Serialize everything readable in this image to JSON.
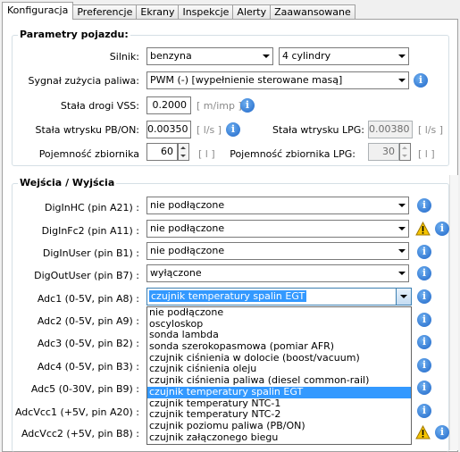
{
  "tabs": [
    "Konfiguracja",
    "Preferencje",
    "Ekrany",
    "Inspekcje",
    "Alerty",
    "Zaawansowane"
  ],
  "vehicle": {
    "title": "Parametry pojazdu:",
    "engine_label": "Silnik:",
    "engine_value": "benzyna",
    "cylinders_value": "4 cylindry",
    "fuel_signal_label": "Sygnał zużycia paliwa:",
    "fuel_signal_value": "PWM (-)  [wypełnienie sterowane masą]",
    "vss_label": "Stała drogi VSS:",
    "vss_value": "0.2000",
    "vss_unit": "[ m/imp ]",
    "pbon_label": "Stała wtrysku PB/ON:",
    "pbon_value": "0.00350",
    "pbon_unit": "[ l/s ]",
    "lpg_label": "Stała wtrysku LPG:",
    "lpg_value": "0.00380",
    "lpg_unit": "[ l/s ]",
    "tank_label": "Pojemność zbiornika",
    "tank_value": "60",
    "tank_unit": "[ l ]",
    "tank_lpg_label": "Pojemność zbiornika LPG:",
    "tank_lpg_value": "30",
    "tank_lpg_unit": "[ l ]"
  },
  "io": {
    "title": "Wejścia / Wyjścia",
    "rows": [
      {
        "label": "DigInHC (pin A21) :",
        "value": "nie podłączone"
      },
      {
        "label": "DigInFc2 (pin A11) :",
        "value": "nie podłączone"
      },
      {
        "label": "DigInUser (pin B1) :",
        "value": "nie podłączone"
      },
      {
        "label": "DigOutUser (pin B7) :",
        "value": "wyłączone"
      },
      {
        "label": "Adc1 (0-5V, pin A8) :",
        "value": "czujnik temperatury spalin EGT"
      },
      {
        "label": "Adc2 (0-5V, pin A9) :"
      },
      {
        "label": "Adc3 (0-5V, pin B2) :"
      },
      {
        "label": "Adc4 (0-5V, pin B3) :"
      },
      {
        "label": "Adc5 (0-30V, pin B9) :"
      },
      {
        "label": "AdcVcc1 (+5V, pin A20) :"
      },
      {
        "label": "AdcVcc2 (+5V, pin B8) :"
      }
    ]
  },
  "dropdown_options": [
    "nie podłączone",
    "oscyloskop",
    "sonda lambda",
    "sonda szerokopasmowa (pomiar AFR)",
    "czujnik ciśnienia w dolocie (boost/vacuum)",
    "czujnik ciśnienia oleju",
    "czujnik ciśnienia paliwa (diesel common-rail)",
    "czujnik temperatury spalin EGT",
    "czujnik temperatury NTC-1",
    "czujnik temperatury NTC-2",
    "czujnik poziomu paliwa (PB/ON)",
    "czujnik załączonego biegu"
  ],
  "dropdown_selected_index": 7,
  "colors": {
    "selection": "#3399ff",
    "info": "#1f66c8",
    "warning": "#f5c400"
  }
}
